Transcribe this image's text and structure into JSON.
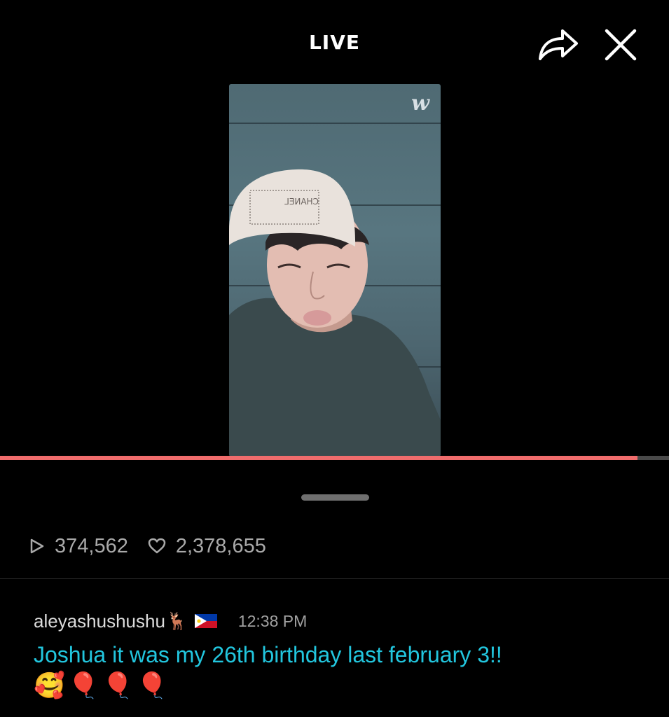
{
  "header": {
    "title": "LIVE",
    "share_icon": "share-icon",
    "close_icon": "close-icon"
  },
  "video": {
    "watermark": "w",
    "progress": 0.953,
    "accent": "#f06c6c"
  },
  "stats": {
    "plays": "374,562",
    "likes": "2,378,655",
    "play_icon": "play-icon",
    "heart_icon": "heart-icon"
  },
  "comment": {
    "username": "aleyashushushu",
    "username_emoji": "🦌",
    "flag": "philippines-flag",
    "time": "12:38 PM",
    "text": "Joshua it was my 26th birthday last february 3!!",
    "emojis": "🥰🎈🎈🎈",
    "text_color": "#22c6de"
  }
}
